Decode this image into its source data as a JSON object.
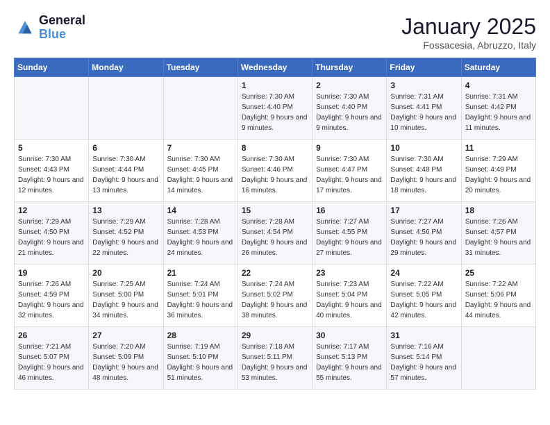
{
  "logo": {
    "line1": "General",
    "line2": "Blue"
  },
  "title": "January 2025",
  "location": "Fossacesia, Abruzzo, Italy",
  "weekdays": [
    "Sunday",
    "Monday",
    "Tuesday",
    "Wednesday",
    "Thursday",
    "Friday",
    "Saturday"
  ],
  "weeks": [
    [
      {
        "day": "",
        "info": ""
      },
      {
        "day": "",
        "info": ""
      },
      {
        "day": "",
        "info": ""
      },
      {
        "day": "1",
        "info": "Sunrise: 7:30 AM\nSunset: 4:40 PM\nDaylight: 9 hours and 9 minutes."
      },
      {
        "day": "2",
        "info": "Sunrise: 7:30 AM\nSunset: 4:40 PM\nDaylight: 9 hours and 9 minutes."
      },
      {
        "day": "3",
        "info": "Sunrise: 7:31 AM\nSunset: 4:41 PM\nDaylight: 9 hours and 10 minutes."
      },
      {
        "day": "4",
        "info": "Sunrise: 7:31 AM\nSunset: 4:42 PM\nDaylight: 9 hours and 11 minutes."
      }
    ],
    [
      {
        "day": "5",
        "info": "Sunrise: 7:30 AM\nSunset: 4:43 PM\nDaylight: 9 hours and 12 minutes."
      },
      {
        "day": "6",
        "info": "Sunrise: 7:30 AM\nSunset: 4:44 PM\nDaylight: 9 hours and 13 minutes."
      },
      {
        "day": "7",
        "info": "Sunrise: 7:30 AM\nSunset: 4:45 PM\nDaylight: 9 hours and 14 minutes."
      },
      {
        "day": "8",
        "info": "Sunrise: 7:30 AM\nSunset: 4:46 PM\nDaylight: 9 hours and 16 minutes."
      },
      {
        "day": "9",
        "info": "Sunrise: 7:30 AM\nSunset: 4:47 PM\nDaylight: 9 hours and 17 minutes."
      },
      {
        "day": "10",
        "info": "Sunrise: 7:30 AM\nSunset: 4:48 PM\nDaylight: 9 hours and 18 minutes."
      },
      {
        "day": "11",
        "info": "Sunrise: 7:29 AM\nSunset: 4:49 PM\nDaylight: 9 hours and 20 minutes."
      }
    ],
    [
      {
        "day": "12",
        "info": "Sunrise: 7:29 AM\nSunset: 4:50 PM\nDaylight: 9 hours and 21 minutes."
      },
      {
        "day": "13",
        "info": "Sunrise: 7:29 AM\nSunset: 4:52 PM\nDaylight: 9 hours and 22 minutes."
      },
      {
        "day": "14",
        "info": "Sunrise: 7:28 AM\nSunset: 4:53 PM\nDaylight: 9 hours and 24 minutes."
      },
      {
        "day": "15",
        "info": "Sunrise: 7:28 AM\nSunset: 4:54 PM\nDaylight: 9 hours and 26 minutes."
      },
      {
        "day": "16",
        "info": "Sunrise: 7:27 AM\nSunset: 4:55 PM\nDaylight: 9 hours and 27 minutes."
      },
      {
        "day": "17",
        "info": "Sunrise: 7:27 AM\nSunset: 4:56 PM\nDaylight: 9 hours and 29 minutes."
      },
      {
        "day": "18",
        "info": "Sunrise: 7:26 AM\nSunset: 4:57 PM\nDaylight: 9 hours and 31 minutes."
      }
    ],
    [
      {
        "day": "19",
        "info": "Sunrise: 7:26 AM\nSunset: 4:59 PM\nDaylight: 9 hours and 32 minutes."
      },
      {
        "day": "20",
        "info": "Sunrise: 7:25 AM\nSunset: 5:00 PM\nDaylight: 9 hours and 34 minutes."
      },
      {
        "day": "21",
        "info": "Sunrise: 7:24 AM\nSunset: 5:01 PM\nDaylight: 9 hours and 36 minutes."
      },
      {
        "day": "22",
        "info": "Sunrise: 7:24 AM\nSunset: 5:02 PM\nDaylight: 9 hours and 38 minutes."
      },
      {
        "day": "23",
        "info": "Sunrise: 7:23 AM\nSunset: 5:04 PM\nDaylight: 9 hours and 40 minutes."
      },
      {
        "day": "24",
        "info": "Sunrise: 7:22 AM\nSunset: 5:05 PM\nDaylight: 9 hours and 42 minutes."
      },
      {
        "day": "25",
        "info": "Sunrise: 7:22 AM\nSunset: 5:06 PM\nDaylight: 9 hours and 44 minutes."
      }
    ],
    [
      {
        "day": "26",
        "info": "Sunrise: 7:21 AM\nSunset: 5:07 PM\nDaylight: 9 hours and 46 minutes."
      },
      {
        "day": "27",
        "info": "Sunrise: 7:20 AM\nSunset: 5:09 PM\nDaylight: 9 hours and 48 minutes."
      },
      {
        "day": "28",
        "info": "Sunrise: 7:19 AM\nSunset: 5:10 PM\nDaylight: 9 hours and 51 minutes."
      },
      {
        "day": "29",
        "info": "Sunrise: 7:18 AM\nSunset: 5:11 PM\nDaylight: 9 hours and 53 minutes."
      },
      {
        "day": "30",
        "info": "Sunrise: 7:17 AM\nSunset: 5:13 PM\nDaylight: 9 hours and 55 minutes."
      },
      {
        "day": "31",
        "info": "Sunrise: 7:16 AM\nSunset: 5:14 PM\nDaylight: 9 hours and 57 minutes."
      },
      {
        "day": "",
        "info": ""
      }
    ]
  ]
}
